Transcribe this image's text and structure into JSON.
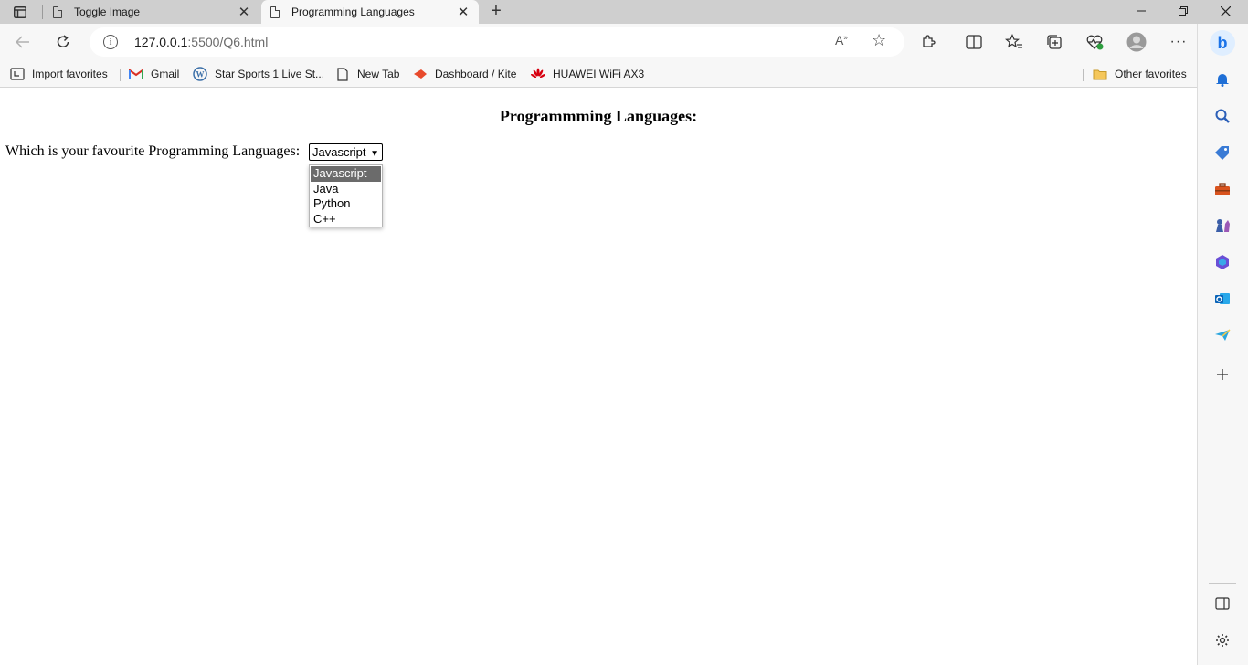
{
  "browser": {
    "tabs": [
      {
        "title": "Toggle Image",
        "active": false
      },
      {
        "title": "Programming Languages",
        "active": true
      }
    ],
    "address": {
      "host": "127.0.0.1",
      "path": ":5500/Q6.html"
    },
    "favorites": [
      {
        "label": "Import favorites",
        "icon": "import-icon"
      },
      {
        "label": "Gmail",
        "icon": "gmail-icon"
      },
      {
        "label": "Star Sports 1 Live St...",
        "icon": "wordpress-icon"
      },
      {
        "label": "New Tab",
        "icon": "page-icon"
      },
      {
        "label": "Dashboard / Kite",
        "icon": "kite-icon"
      },
      {
        "label": "HUAWEI WiFi AX3",
        "icon": "huawei-icon"
      }
    ],
    "other_favorites": "Other favorites"
  },
  "page": {
    "heading": "Programmming Languages:",
    "question": "Which is your favourite Programming Languages:",
    "select": {
      "selected": "Javascript",
      "options": [
        "Javascript",
        "Java",
        "Python",
        "C++"
      ]
    }
  },
  "colors": {
    "tabstrip": "#cfcfcf",
    "toolbar": "#f7f7f7",
    "highlight": "#6b6b6b",
    "bing_blue": "#1a73e8"
  }
}
